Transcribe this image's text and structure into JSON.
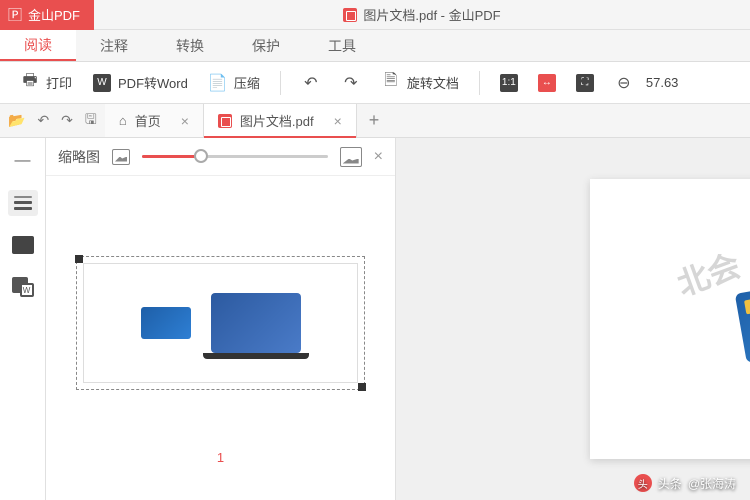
{
  "app": {
    "name": "金山PDF",
    "title": "图片文档.pdf - 金山PDF"
  },
  "menu": {
    "read": "阅读",
    "annotate": "注释",
    "convert": "转换",
    "protect": "保护",
    "tools": "工具"
  },
  "toolbar": {
    "print": "打印",
    "pdf2word": "PDF转Word",
    "compress": "压缩",
    "rotate": "旋转文档",
    "zoom": "57.63"
  },
  "tabs": {
    "home": "首页",
    "doc1": "图片文档.pdf"
  },
  "panel": {
    "thumbnails": "缩略图",
    "page_num": "1"
  },
  "credit": {
    "prefix": "头条",
    "author": "@张海涛"
  },
  "watermark": "北会"
}
